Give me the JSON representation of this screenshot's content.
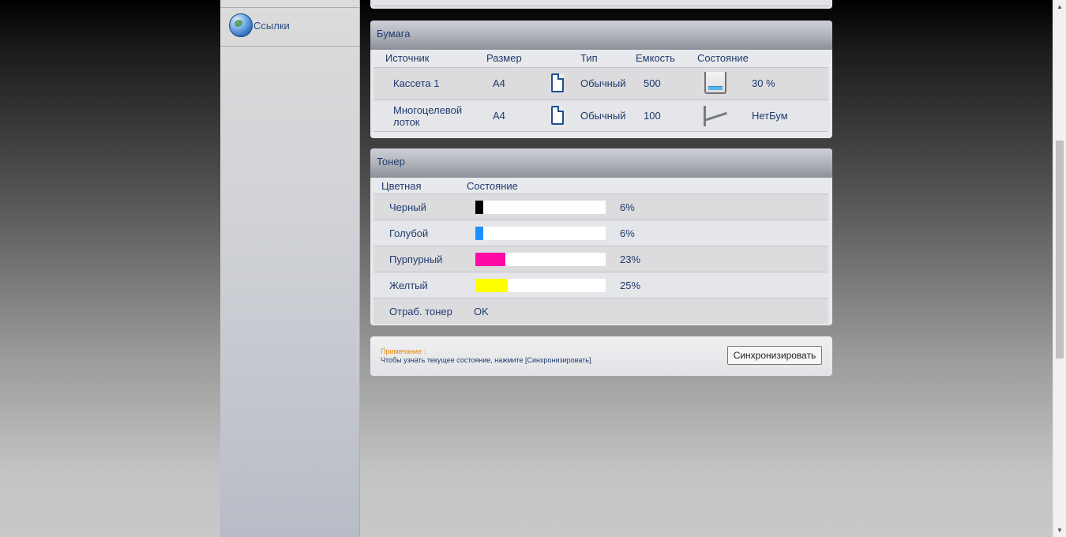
{
  "sidebar": {
    "links_label": "Ссылки"
  },
  "paper": {
    "title": "Бумага",
    "columns": [
      "Источник",
      "Размер",
      "Тип",
      "Емкость",
      "Состояние"
    ],
    "rows": [
      {
        "source": "Кассета 1",
        "size": "A4",
        "type": "Обычный",
        "capacity": "500",
        "status": "30 %",
        "level_fraction": 0.3
      },
      {
        "source": "Многоцелевой лоток",
        "size": "A4",
        "type": "Обычный",
        "capacity": "100",
        "status": "НетБум"
      }
    ]
  },
  "toner": {
    "title": "Тонер",
    "columns": [
      "Цветная",
      "Состояние"
    ],
    "rows": [
      {
        "name": "Черный",
        "percent_label": "6%",
        "percent": 6,
        "color": "#000000"
      },
      {
        "name": "Голубой",
        "percent_label": "6%",
        "percent": 6,
        "color": "#1e90ff"
      },
      {
        "name": "Пурпурный",
        "percent_label": "23%",
        "percent": 23,
        "color": "#ff0aa5"
      },
      {
        "name": "Желтый",
        "percent_label": "25%",
        "percent": 25,
        "color": "#ffff00"
      }
    ],
    "waste_label": "Отраб. тонер",
    "waste_status": "OK"
  },
  "note": {
    "title": "Примечание :",
    "text": "Чтобы узнать текущее состояние, нажмите [Синхронизировать].",
    "button_label": "Синхронизировать"
  }
}
